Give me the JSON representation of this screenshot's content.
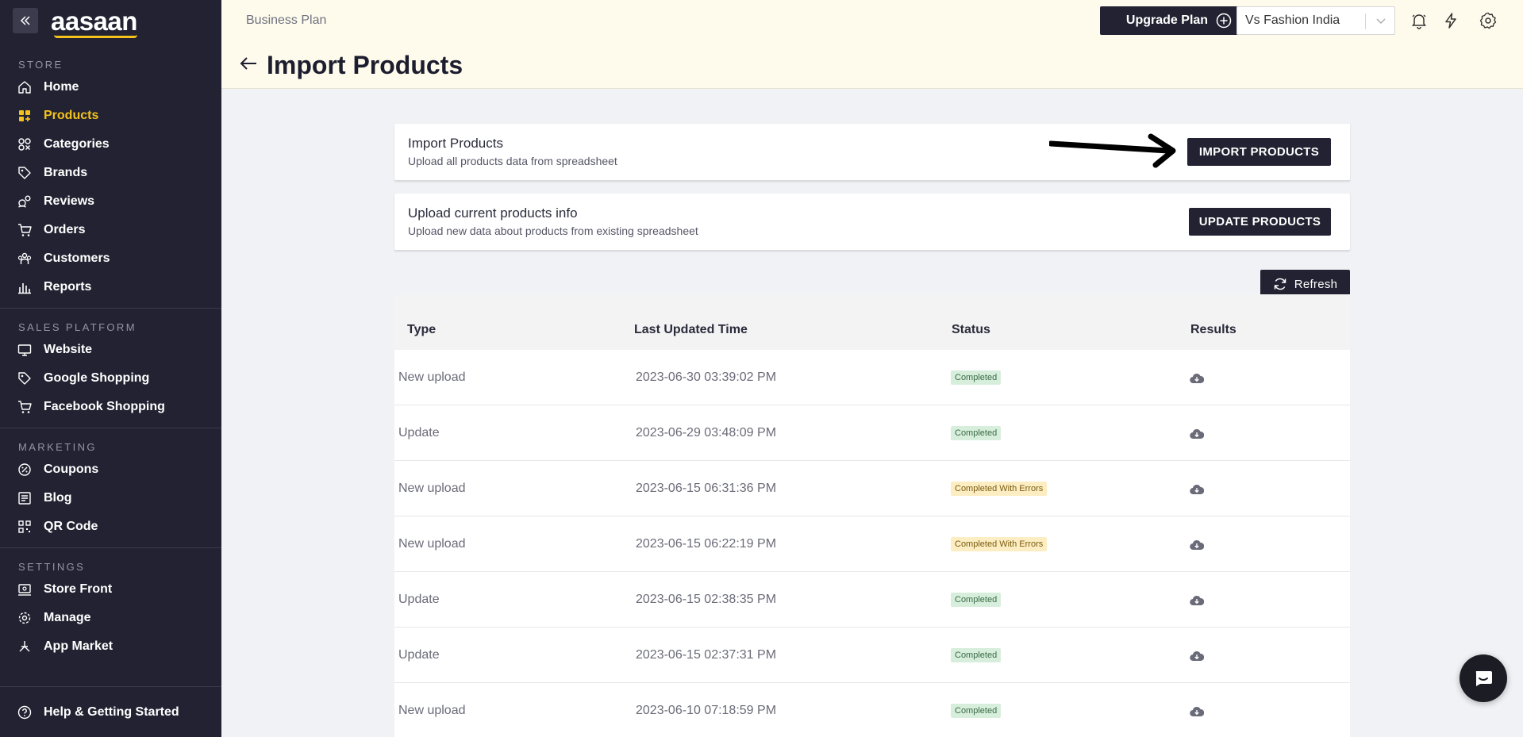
{
  "app": {
    "logo_text": "aasaan"
  },
  "sidebar": {
    "sections": [
      {
        "label": "STORE",
        "items": [
          {
            "label": "Home",
            "icon": "home-icon"
          },
          {
            "label": "Products",
            "icon": "products-icon",
            "active": true
          },
          {
            "label": "Categories",
            "icon": "categories-icon"
          },
          {
            "label": "Brands",
            "icon": "tag-icon"
          },
          {
            "label": "Reviews",
            "icon": "reviews-icon"
          },
          {
            "label": "Orders",
            "icon": "cart-icon"
          },
          {
            "label": "Customers",
            "icon": "users-icon"
          },
          {
            "label": "Reports",
            "icon": "bar-chart-icon"
          }
        ]
      },
      {
        "label": "SALES PLATFORM",
        "items": [
          {
            "label": "Website",
            "icon": "monitor-icon"
          },
          {
            "label": "Google Shopping",
            "icon": "tag-icon"
          },
          {
            "label": "Facebook Shopping",
            "icon": "cart-icon"
          }
        ]
      },
      {
        "label": "MARKETING",
        "items": [
          {
            "label": "Coupons",
            "icon": "coupon-icon"
          },
          {
            "label": "Blog",
            "icon": "blog-icon"
          },
          {
            "label": "QR Code",
            "icon": "qr-icon"
          }
        ]
      },
      {
        "label": "SETTINGS",
        "items": [
          {
            "label": "Store Front",
            "icon": "storefront-icon"
          },
          {
            "label": "Manage",
            "icon": "gear-icon"
          },
          {
            "label": "App Market",
            "icon": "app-market-icon"
          }
        ]
      }
    ],
    "help_label": "Help & Getting Started"
  },
  "header": {
    "plan_label": "Business Plan",
    "page_title": "Import Products",
    "upgrade_label": "Upgrade Plan",
    "store_name": "Vs Fashion India"
  },
  "import_card": {
    "title": "Import Products",
    "subtitle": "Upload all products data from spreadsheet",
    "button_label": "IMPORT PRODUCTS"
  },
  "update_card": {
    "title": "Upload current products info",
    "subtitle": "Upload new data about products from existing spreadsheet",
    "button_label": "UPDATE PRODUCTS"
  },
  "refresh_label": "Refresh",
  "table": {
    "headers": [
      "Type",
      "Last Updated Time",
      "Status",
      "Results"
    ],
    "rows": [
      {
        "type": "New upload",
        "time": "2023-06-30 03:39:02 PM",
        "status": "Completed"
      },
      {
        "type": "Update",
        "time": "2023-06-29 03:48:09 PM",
        "status": "Completed"
      },
      {
        "type": "New upload",
        "time": "2023-06-15 06:31:36 PM",
        "status": "Completed With Errors"
      },
      {
        "type": "New upload",
        "time": "2023-06-15 06:22:19 PM",
        "status": "Completed With Errors"
      },
      {
        "type": "Update",
        "time": "2023-06-15 02:38:35 PM",
        "status": "Completed"
      },
      {
        "type": "Update",
        "time": "2023-06-15 02:37:31 PM",
        "status": "Completed"
      },
      {
        "type": "New upload",
        "time": "2023-06-10 07:18:59 PM",
        "status": "Completed"
      }
    ]
  },
  "colors": {
    "sidebar_bg": "#222232",
    "accent": "#f4c21d",
    "header_bg": "#fefbec"
  }
}
